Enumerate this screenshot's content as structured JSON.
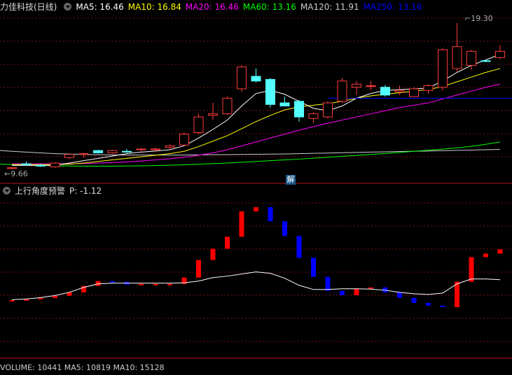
{
  "header_top": {
    "stock_name": "力佳科技(日线)",
    "ma_items": [
      {
        "label": "MA5: 16.46",
        "color": "#ffffff"
      },
      {
        "label": "MA10: 16.84",
        "color": "#ffff00"
      },
      {
        "label": "MA20: 16.46",
        "color": "#ff00ff"
      },
      {
        "label": "MA60: 13.16",
        "color": "#00ff00"
      },
      {
        "label": "MA120: 11.91",
        "color": "#cccccc"
      },
      {
        "label": "MA250: 13.16",
        "color": "#0000ff"
      }
    ]
  },
  "header_bottom": {
    "indicator_name": "上行角度预警",
    "value_label": "P: -1.12"
  },
  "labels": {
    "high_price": "19.30",
    "low_price": "9.66",
    "jie_button": "解"
  },
  "footer_partial": "VOLUME: 10441  MA5: 10819  MA10: 15128",
  "chart_data": {
    "type": "candlestick",
    "candles": [
      {
        "o": 10.0,
        "h": 10.1,
        "l": 9.95,
        "c": 10.05
      },
      {
        "o": 10.3,
        "h": 10.45,
        "l": 10.2,
        "c": 10.25
      },
      {
        "o": 10.2,
        "h": 10.3,
        "l": 10.1,
        "c": 10.15
      },
      {
        "o": 10.1,
        "h": 10.4,
        "l": 10.05,
        "c": 10.35
      },
      {
        "o": 10.7,
        "h": 10.95,
        "l": 10.6,
        "c": 10.9
      },
      {
        "o": 10.95,
        "h": 11.0,
        "l": 10.7,
        "c": 10.95
      },
      {
        "o": 11.15,
        "h": 11.2,
        "l": 10.95,
        "c": 11.0
      },
      {
        "o": 11.0,
        "h": 11.2,
        "l": 10.95,
        "c": 11.15
      },
      {
        "o": 11.1,
        "h": 11.25,
        "l": 11.0,
        "c": 11.05
      },
      {
        "o": 11.2,
        "h": 11.3,
        "l": 11.0,
        "c": 11.25
      },
      {
        "o": 11.2,
        "h": 11.35,
        "l": 11.05,
        "c": 11.25
      },
      {
        "o": 11.35,
        "h": 11.55,
        "l": 11.2,
        "c": 11.45
      },
      {
        "o": 11.5,
        "h": 12.3,
        "l": 11.45,
        "c": 12.2
      },
      {
        "o": 12.3,
        "h": 13.5,
        "l": 12.2,
        "c": 13.3
      },
      {
        "o": 13.4,
        "h": 14.2,
        "l": 13.1,
        "c": 13.5
      },
      {
        "o": 13.5,
        "h": 14.6,
        "l": 13.4,
        "c": 14.5
      },
      {
        "o": 15.1,
        "h": 16.6,
        "l": 14.9,
        "c": 16.5
      },
      {
        "o": 15.9,
        "h": 16.4,
        "l": 15.5,
        "c": 15.6
      },
      {
        "o": 15.7,
        "h": 15.8,
        "l": 13.9,
        "c": 14.1
      },
      {
        "o": 14.2,
        "h": 14.6,
        "l": 14.0,
        "c": 14.0
      },
      {
        "o": 14.3,
        "h": 14.4,
        "l": 13.0,
        "c": 13.3
      },
      {
        "o": 13.2,
        "h": 13.6,
        "l": 12.9,
        "c": 13.5
      },
      {
        "o": 13.3,
        "h": 14.3,
        "l": 13.2,
        "c": 14.2
      },
      {
        "o": 14.3,
        "h": 15.8,
        "l": 14.2,
        "c": 15.6
      },
      {
        "o": 15.2,
        "h": 15.6,
        "l": 14.7,
        "c": 15.4
      },
      {
        "o": 15.3,
        "h": 15.6,
        "l": 15.0,
        "c": 15.3
      },
      {
        "o": 15.2,
        "h": 15.35,
        "l": 14.6,
        "c": 14.7
      },
      {
        "o": 14.9,
        "h": 15.3,
        "l": 14.7,
        "c": 15.0
      },
      {
        "o": 14.6,
        "h": 15.2,
        "l": 14.6,
        "c": 15.1
      },
      {
        "o": 15.0,
        "h": 15.4,
        "l": 14.8,
        "c": 15.3
      },
      {
        "o": 15.2,
        "h": 17.7,
        "l": 15.0,
        "c": 17.6
      },
      {
        "o": 16.4,
        "h": 19.3,
        "l": 16.2,
        "c": 17.8
      },
      {
        "o": 16.6,
        "h": 17.6,
        "l": 16.3,
        "c": 17.5
      },
      {
        "o": 16.9,
        "h": 16.95,
        "l": 16.8,
        "c": 16.85
      },
      {
        "o": 17.1,
        "h": 17.9,
        "l": 17.0,
        "c": 17.5
      }
    ],
    "ma5": [
      10.2,
      10.2,
      10.2,
      10.2,
      10.35,
      10.5,
      10.65,
      10.8,
      10.95,
      11.05,
      11.12,
      11.2,
      11.45,
      11.95,
      12.5,
      13.1,
      14.0,
      14.8,
      15.0,
      14.75,
      14.3,
      13.85,
      13.7,
      14.0,
      14.5,
      14.8,
      15.0,
      15.05,
      15.1,
      15.15,
      15.6,
      16.15,
      16.6,
      16.95,
      17.3
    ],
    "ma10": [
      10.25,
      10.25,
      10.25,
      10.25,
      10.28,
      10.35,
      10.45,
      10.55,
      10.65,
      10.75,
      10.85,
      10.95,
      11.1,
      11.4,
      11.75,
      12.1,
      12.55,
      13.0,
      13.4,
      13.75,
      13.95,
      14.05,
      14.15,
      14.3,
      14.5,
      14.65,
      14.75,
      14.85,
      14.95,
      15.05,
      15.25,
      15.55,
      15.85,
      16.15,
      16.4
    ],
    "ma20": [
      10.3,
      10.3,
      10.3,
      10.3,
      10.3,
      10.32,
      10.35,
      10.38,
      10.42,
      10.48,
      10.55,
      10.62,
      10.72,
      10.85,
      11.0,
      11.2,
      11.45,
      11.7,
      11.95,
      12.2,
      12.45,
      12.68,
      12.9,
      13.1,
      13.3,
      13.5,
      13.7,
      13.9,
      14.05,
      14.2,
      14.45,
      14.7,
      14.95,
      15.2,
      15.4
    ],
    "ma60": [
      10.25,
      10.22,
      10.2,
      10.18,
      10.16,
      10.15,
      10.15,
      10.15,
      10.16,
      10.17,
      10.19,
      10.21,
      10.24,
      10.27,
      10.31,
      10.35,
      10.4,
      10.45,
      10.5,
      10.55,
      10.6,
      10.66,
      10.72,
      10.78,
      10.84,
      10.9,
      10.96,
      11.03,
      11.1,
      11.17,
      11.24,
      11.32,
      11.42,
      11.55,
      11.7
    ],
    "ma120": [
      11.1,
      11.05,
      11.0,
      10.95,
      10.92,
      10.9,
      10.88,
      10.87,
      10.86,
      10.86,
      10.86,
      10.86,
      10.86,
      10.87,
      10.88,
      10.89,
      10.9,
      10.91,
      10.92,
      10.93,
      10.95,
      10.97,
      10.99,
      11.01,
      11.03,
      11.05,
      11.07,
      11.09,
      11.1,
      11.12,
      11.14,
      11.16,
      11.18,
      11.2,
      11.22
    ],
    "ma250_seg": {
      "from_index": 22,
      "value": 14.5
    },
    "price_range": [
      9.5,
      19.8
    ],
    "indicator": {
      "values": [
        0.2,
        0.3,
        0.5,
        0.8,
        1.3,
        2.2,
        2.9,
        2.8,
        2.4,
        2.5,
        2.5,
        2.5,
        3.4,
        5.9,
        7.5,
        9.2,
        12.8,
        13.4,
        11.4,
        9.3,
        6.2,
        3.5,
        1.5,
        0.9,
        1.8,
        2.0,
        1.3,
        0.5,
        -0.2,
        -0.6,
        -0.8,
        2.8,
        6.3,
        6.8,
        7.4
      ],
      "baseline": [
        0.25,
        0.35,
        0.55,
        0.85,
        1.3,
        2.0,
        2.5,
        2.6,
        2.6,
        2.6,
        2.6,
        2.6,
        2.65,
        2.9,
        3.4,
        3.6,
        3.9,
        4.2,
        4.0,
        3.3,
        2.3,
        1.7,
        1.7,
        1.8,
        1.8,
        1.75,
        1.6,
        1.3,
        1.1,
        1.0,
        1.2,
        2.5,
        3.2,
        3.2,
        3.1
      ],
      "range": [
        -1.5,
        15.0
      ]
    }
  },
  "colors": {
    "up": "#ff3c3c",
    "down": "#54ffff",
    "grid": "#7a1010",
    "ind_up": "#ff0000",
    "ind_down": "#0000ff"
  }
}
